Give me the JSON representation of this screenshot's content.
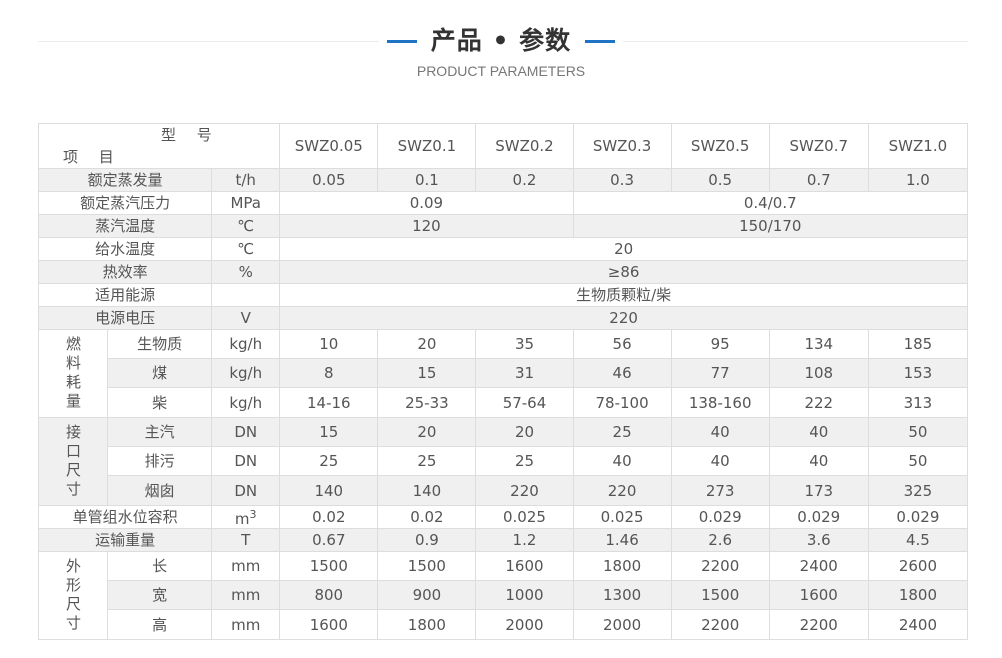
{
  "header": {
    "title": "产品 • 参数",
    "subtitle": "PRODUCT PARAMETERS"
  },
  "table": {
    "header_model": "型 号",
    "header_item": "项 目",
    "models": [
      "SWZ0.05",
      "SWZ0.1",
      "SWZ0.2",
      "SWZ0.3",
      "SWZ0.5",
      "SWZ0.7",
      "SWZ1.0"
    ],
    "rated_evaporation": {
      "label": "额定蒸发量",
      "unit": "t/h",
      "values": [
        "0.05",
        "0.1",
        "0.2",
        "0.3",
        "0.5",
        "0.7",
        "1.0"
      ]
    },
    "rated_pressure": {
      "label": "额定蒸汽压力",
      "unit": "MPa",
      "value_a": "0.09",
      "value_b": "0.4/0.7"
    },
    "steam_temp": {
      "label": "蒸汽温度",
      "unit": "℃",
      "value_a": "120",
      "value_b": "150/170"
    },
    "feedwater_temp": {
      "label": "给水温度",
      "unit": "℃",
      "value": "20"
    },
    "thermal_efficiency": {
      "label": "热效率",
      "unit": "%",
      "value": "≥86"
    },
    "energy_source": {
      "label": "适用能源",
      "unit": "",
      "value": "生物质颗粒/柴"
    },
    "voltage": {
      "label": "电源电压",
      "unit": "V",
      "value": "220"
    },
    "fuel_consumption": {
      "group_label": "燃料耗量",
      "rows": [
        {
          "label": "生物质",
          "unit": "kg/h",
          "values": [
            "10",
            "20",
            "35",
            "56",
            "95",
            "134",
            "185"
          ]
        },
        {
          "label": "煤",
          "unit": "kg/h",
          "values": [
            "8",
            "15",
            "31",
            "46",
            "77",
            "108",
            "153"
          ]
        },
        {
          "label": "柴",
          "unit": "kg/h",
          "values": [
            "14-16",
            "25-33",
            "57-64",
            "78-100",
            "138-160",
            "222",
            "313"
          ]
        }
      ]
    },
    "interface_size": {
      "group_label": "接口尺寸",
      "rows": [
        {
          "label": "主汽",
          "unit": "DN",
          "values": [
            "15",
            "20",
            "20",
            "25",
            "40",
            "40",
            "50"
          ]
        },
        {
          "label": "排污",
          "unit": "DN",
          "values": [
            "25",
            "25",
            "25",
            "40",
            "40",
            "40",
            "50"
          ]
        },
        {
          "label": "烟囱",
          "unit": "DN",
          "values": [
            "140",
            "140",
            "220",
            "220",
            "273",
            "173",
            "325"
          ]
        }
      ]
    },
    "water_volume": {
      "label": "单管组水位容积",
      "unit": "m",
      "unit_sup": "3",
      "values": [
        "0.02",
        "0.02",
        "0.025",
        "0.025",
        "0.029",
        "0.029",
        "0.029"
      ]
    },
    "transport_weight": {
      "label": "运输重量",
      "unit": "T",
      "values": [
        "0.67",
        "0.9",
        "1.2",
        "1.46",
        "2.6",
        "3.6",
        "4.5"
      ]
    },
    "dimensions": {
      "group_label": "外形尺寸",
      "rows": [
        {
          "label": "长",
          "unit": "mm",
          "values": [
            "1500",
            "1500",
            "1600",
            "1800",
            "2200",
            "2400",
            "2600"
          ]
        },
        {
          "label": "宽",
          "unit": "mm",
          "values": [
            "800",
            "900",
            "1000",
            "1300",
            "1500",
            "1600",
            "1800"
          ]
        },
        {
          "label": "高",
          "unit": "mm",
          "values": [
            "1600",
            "1800",
            "2000",
            "2000",
            "2200",
            "2200",
            "2400"
          ]
        }
      ]
    }
  },
  "colors": {
    "accent": "#1f73c4",
    "row_gray": "#f0f0f0",
    "border": "#dddddd"
  }
}
